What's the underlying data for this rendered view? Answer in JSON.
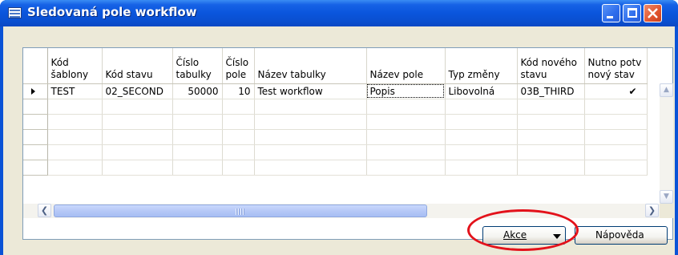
{
  "window": {
    "title": "Sledovaná pole workflow"
  },
  "grid": {
    "columns": [
      {
        "key": "sablona",
        "label_lines": [
          "Kód",
          "šablony"
        ]
      },
      {
        "key": "stav",
        "label_lines": [
          "",
          "Kód stavu"
        ]
      },
      {
        "key": "tabulka",
        "label_lines": [
          "Číslo",
          "tabulky"
        ]
      },
      {
        "key": "pole",
        "label_lines": [
          "Číslo",
          "pole"
        ]
      },
      {
        "key": "nazev_tabulky",
        "label_lines": [
          "",
          "Název tabulky"
        ]
      },
      {
        "key": "nazev_pole",
        "label_lines": [
          "",
          "Název pole"
        ]
      },
      {
        "key": "typ_zmeny",
        "label_lines": [
          "",
          "Typ změny"
        ]
      },
      {
        "key": "novy_stav",
        "label_lines": [
          "Kód nového",
          "stavu"
        ]
      },
      {
        "key": "nutno_potv",
        "label_lines": [
          "Nutno potv",
          "nový stav"
        ]
      }
    ],
    "rows": [
      {
        "kod_sablony": "TEST",
        "kod_stavu": "02_SECOND",
        "cislo_tabulky": "50000",
        "cislo_pole": "10",
        "nazev_tabulky": "Test workflow",
        "nazev_pole": "Popis",
        "typ_zmeny": "Libovolná",
        "kod_noveho_stavu": "03B_THIRD",
        "nutno_potvrdit": "✔"
      }
    ],
    "empty_row_count": 5
  },
  "buttons": {
    "akce": "Akce",
    "napoveda": "Nápověda"
  },
  "colors": {
    "titlebar": "#0a55dc",
    "client_bg": "#ece9d8",
    "highlight": "#e3121b"
  }
}
